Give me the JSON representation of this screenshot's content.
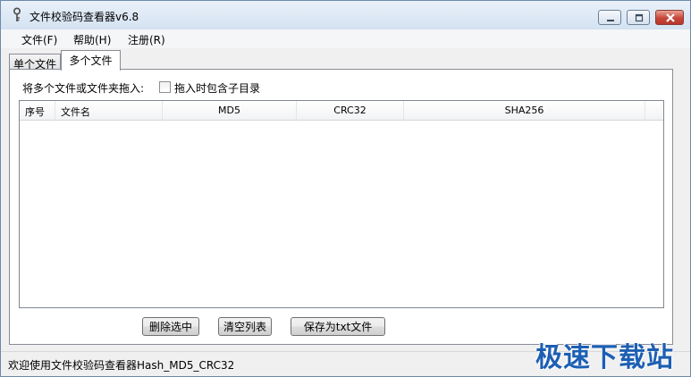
{
  "window": {
    "title": "文件校验码查看器v6.8"
  },
  "menu": {
    "items": [
      "文件(F)",
      "帮助(H)",
      "注册(R)"
    ]
  },
  "tabs": {
    "single": "单个文件",
    "multi": "多个文件"
  },
  "panel": {
    "drop_label": "将多个文件或文件夹拖入:",
    "include_subdirs_label": "拖入时包含子目录",
    "include_subdirs_checked": false
  },
  "table": {
    "columns": [
      "序号",
      "文件名",
      "MD5",
      "CRC32",
      "SHA256"
    ],
    "rows": []
  },
  "buttons": {
    "delete": "删除选中",
    "clear": "清空列表",
    "save": "保存为txt文件"
  },
  "status": {
    "text": "欢迎使用文件校验码查看器Hash_MD5_CRC32"
  },
  "watermark": {
    "text": "极速下载站"
  },
  "colors": {
    "title_gradient_top": "#e9f1fa",
    "close_button": "#c7473a",
    "watermark": "#1d5fb3"
  }
}
